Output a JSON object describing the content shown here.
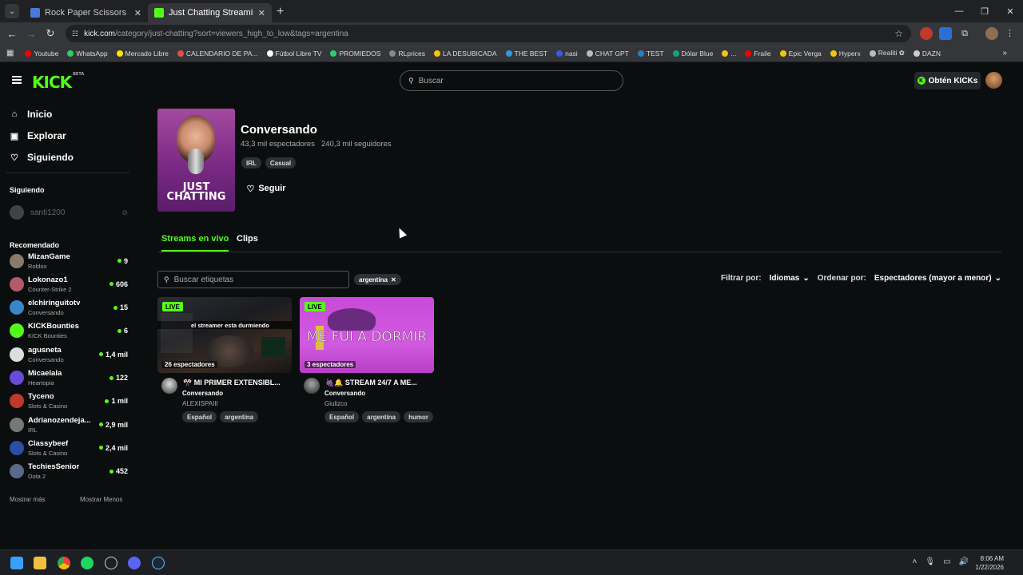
{
  "browser": {
    "tabs": [
      {
        "title": "Rock Paper Scissors - Play Onli",
        "favicon_color": "#4a7ad9"
      },
      {
        "title": "Just Chatting Streaming - Live S",
        "favicon_color": "#53fc18"
      }
    ],
    "url_domain": "kick.com",
    "url_path": "/category/just-chatting?sort=viewers_high_to_low&tags=argentina",
    "bookmarks": [
      {
        "label": "Youtube",
        "color": "#ff0000"
      },
      {
        "label": "WhatsApp",
        "color": "#25d366"
      },
      {
        "label": "Mercado Libre",
        "color": "#ffe600"
      },
      {
        "label": "CALENDARIO DE PA...",
        "color": "#e74c3c"
      },
      {
        "label": "Fútbol Libre TV",
        "color": "#ffffff"
      },
      {
        "label": "PROMIEDOS",
        "color": "#2ecc71"
      },
      {
        "label": "RLprices",
        "color": "#888888"
      },
      {
        "label": "LA DESUBICADA",
        "color": "#f1c40f"
      },
      {
        "label": "THE BEST",
        "color": "#3498db"
      },
      {
        "label": "nasi",
        "color": "#3b5bdb"
      },
      {
        "label": "CHAT GPT",
        "color": "#bbbbbb"
      },
      {
        "label": "TEST",
        "color": "#2980b9"
      },
      {
        "label": "Dólar Blue",
        "color": "#16a085"
      },
      {
        "label": "...",
        "color": "#f1c40f"
      },
      {
        "label": "Fraile",
        "color": "#ff0000"
      },
      {
        "label": "Epic Verga",
        "color": "#f1c40f"
      },
      {
        "label": "Hyperx",
        "color": "#f1c40f"
      },
      {
        "label": "Realiti ✿",
        "color": "#bbbbbb"
      },
      {
        "label": "DAZN",
        "color": "#cccccc"
      }
    ]
  },
  "header": {
    "logo": "KICK",
    "logo_beta": "BETA",
    "search_placeholder": "Buscar",
    "kicks_button": "Obtén KICKs",
    "accent": "#53fc18"
  },
  "sidebar": {
    "nav": [
      {
        "label": "Inicio",
        "icon": "home-icon"
      },
      {
        "label": "Explorar",
        "icon": "compass-icon"
      },
      {
        "label": "Siguiendo",
        "icon": "heart-icon"
      }
    ],
    "following_title": "Siguiendo",
    "following": [
      {
        "name": "santi1200"
      }
    ],
    "recommended_title": "Recomendado",
    "recommended": [
      {
        "name": "MizanGame",
        "category": "Roblox",
        "viewers": "9",
        "color": "#8a7a6a"
      },
      {
        "name": "Lokonazo1",
        "category": "Counter-Strike 2",
        "viewers": "606",
        "color": "#b35a6a"
      },
      {
        "name": "elchiringuitotv",
        "category": "Conversando",
        "viewers": "15",
        "color": "#3a86c8"
      },
      {
        "name": "KICKBounties",
        "category": "KICK Bounties",
        "viewers": "6",
        "color": "#53fc18"
      },
      {
        "name": "agusneta",
        "category": "Conversando",
        "viewers": "1,4 mil",
        "color": "#dddddd"
      },
      {
        "name": "Micaelala",
        "category": "Heartopia",
        "viewers": "122",
        "color": "#6a4ad9"
      },
      {
        "name": "Tyceno",
        "category": "Slots & Casino",
        "viewers": "1 mil",
        "color": "#c0392b"
      },
      {
        "name": "Adrianozendeja...",
        "category": "IRL",
        "viewers": "2,9 mil",
        "color": "#777777"
      },
      {
        "name": "Classybeef",
        "category": "Slots & Casino",
        "viewers": "2,4 mil",
        "color": "#2c4fa3"
      },
      {
        "name": "TechiesSenior",
        "category": "Dota 2",
        "viewers": "452",
        "color": "#5a6a8a"
      }
    ],
    "show_more": "Mostrar más",
    "show_less": "Mostrar Menos"
  },
  "category": {
    "title": "Conversando",
    "viewers": "43,3 mil espectadores",
    "followers": "240,3 mil seguidores",
    "tags": [
      "IRL",
      "Casual"
    ],
    "follow_label": "Seguir",
    "cover_caption": "JUST CHATTING"
  },
  "tabs": [
    {
      "label": "Streams en vivo",
      "active": true
    },
    {
      "label": "Clips",
      "active": false
    }
  ],
  "filters": {
    "tag_search_placeholder": "Buscar etiquetas",
    "active_tag": "argentina",
    "filter_label": "Filtrar por:",
    "language": "Idiomas",
    "sort_label": "Ordenar por:",
    "sort_value": "Espectadores (mayor a menor)"
  },
  "streams": [
    {
      "live": "LIVE",
      "viewers": "26 espectadores",
      "thumb_text": "el streamer esta durmiendo",
      "title": "🎌 MI PRIMER EXTENSIBL...",
      "category": "Conversando",
      "streamer": "ALEXISPAIII",
      "tags": [
        "Español",
        "argentina"
      ]
    },
    {
      "live": "LIVE",
      "viewers": "3 espectadores",
      "thumb_text": "ME FUI A DORMIR",
      "title": "🍇🔔 STREAM 24/7 A ME...",
      "category": "Conversando",
      "streamer": "Giulizco",
      "tags": [
        "Español",
        "argentina",
        "humor"
      ]
    }
  ],
  "taskbar": {
    "time": "8:06 AM",
    "date": "1/22/2026"
  }
}
